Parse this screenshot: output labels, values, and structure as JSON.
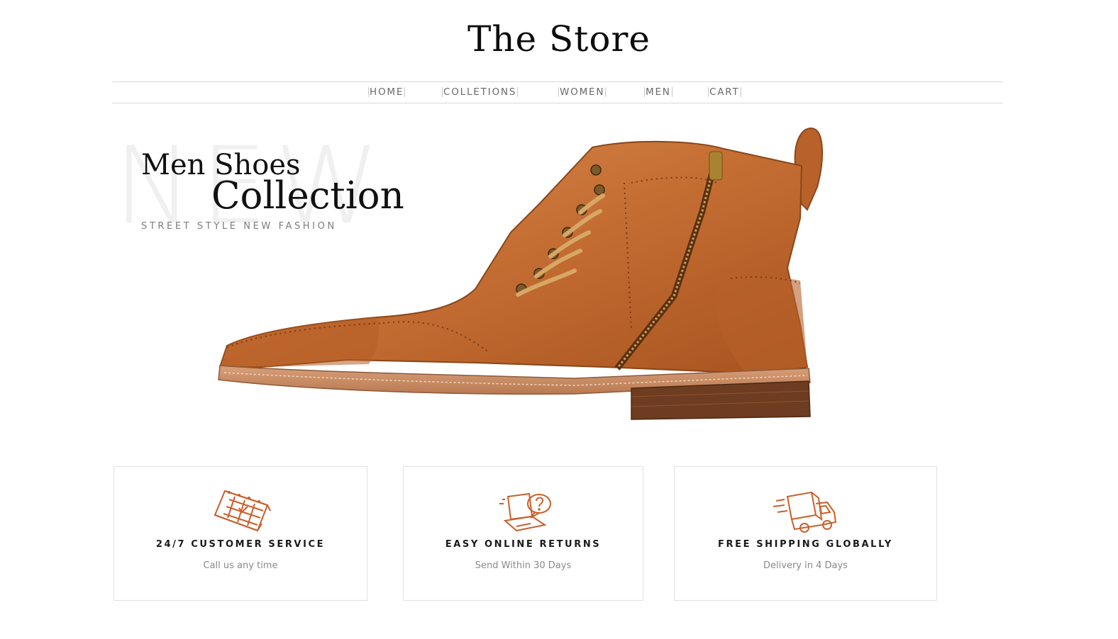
{
  "header": {
    "title": "The Store"
  },
  "nav": {
    "items": [
      {
        "label": "HOME"
      },
      {
        "label": "COLLETIONS"
      },
      {
        "label": "WOMEN"
      },
      {
        "label": "MEN"
      },
      {
        "label": "CART"
      }
    ]
  },
  "hero": {
    "background_word": "NEW",
    "title_line1": "Men Shoes",
    "title_line2": "Collection",
    "subtitle": "STREET STYLE NEW FASHION",
    "image_icon": "boot-image"
  },
  "features": [
    {
      "icon": "calendar-icon",
      "title": "24/7 CUSTOMER SERVICE",
      "subtitle": "Call us any time"
    },
    {
      "icon": "laptop-chat-icon",
      "title": "EASY ONLINE RETURNS",
      "subtitle": "Send Within 30 Days"
    },
    {
      "icon": "delivery-truck-icon",
      "title": "FREE SHIPPING GLOBALLY",
      "subtitle": "Delivery in 4 Days"
    }
  ],
  "colors": {
    "accent": "#c8602a",
    "leather": "#c06a32",
    "text": "#111111",
    "muted": "#8a8a8a"
  }
}
